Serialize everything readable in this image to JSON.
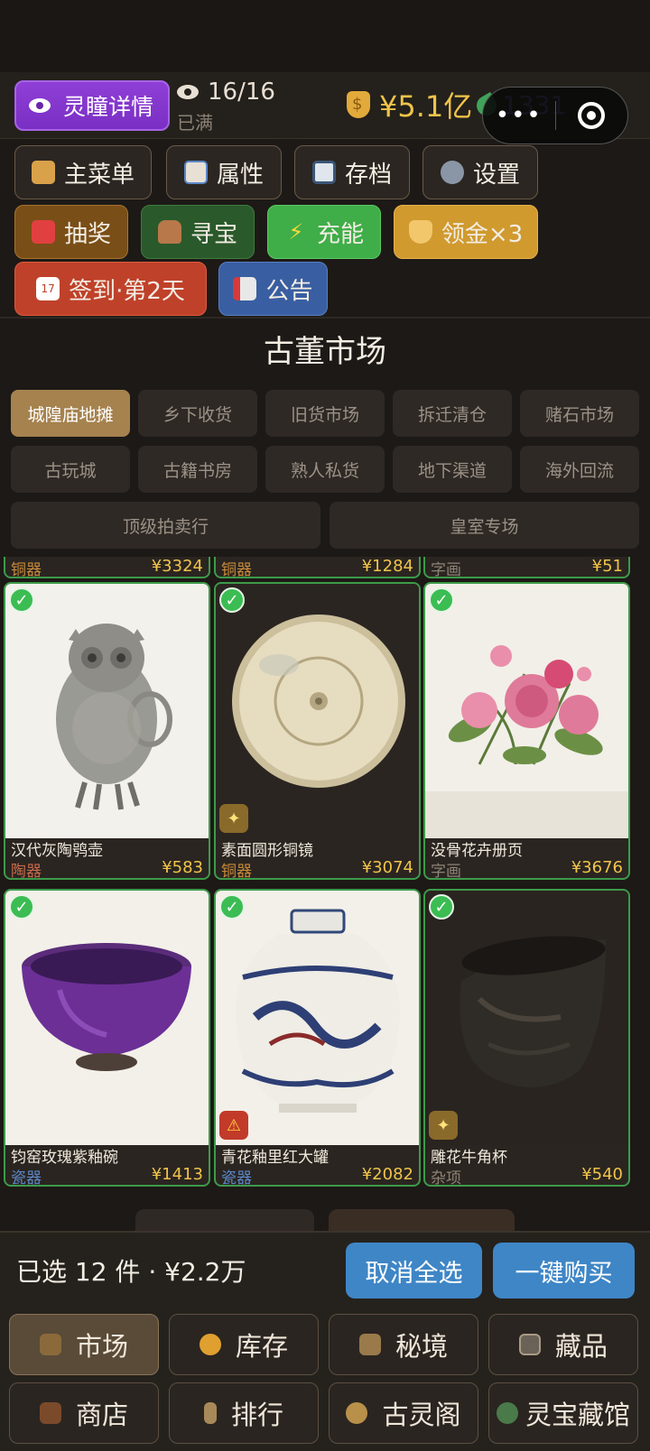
{
  "header": {
    "lingtong_label": "灵瞳详情",
    "view_count": "16/16",
    "view_status": "已满",
    "money": "¥5.1亿",
    "jade": "1331"
  },
  "menu": {
    "row1": [
      {
        "label": "主菜单",
        "icon": "house-icon"
      },
      {
        "label": "属性",
        "icon": "chart-icon"
      },
      {
        "label": "存档",
        "icon": "floppy-icon"
      },
      {
        "label": "设置",
        "icon": "gear-icon"
      }
    ],
    "row2": [
      {
        "label": "抽奖",
        "icon": "dice-icon"
      },
      {
        "label": "寻宝",
        "icon": "vase-icon"
      },
      {
        "label": "充能",
        "icon": "lightning-icon"
      },
      {
        "label": "领金×3",
        "icon": "money-bag-icon"
      }
    ],
    "row3": [
      {
        "label": "签到·第2天",
        "icon": "calendar-icon"
      },
      {
        "label": "公告",
        "icon": "megaphone-icon"
      }
    ],
    "calendar_day": "17"
  },
  "market": {
    "title": "古董市场",
    "tabs_row1": [
      "城隍庙地摊",
      "乡下收货",
      "旧货市场",
      "拆迁清仓",
      "赌石市场"
    ],
    "tabs_row2": [
      "古玩城",
      "古籍书房",
      "熟人私货",
      "地下渠道",
      "海外回流"
    ],
    "tabs_row3": [
      "顶级拍卖行",
      "皇室专场"
    ],
    "active_tab": "城隍庙地摊"
  },
  "partial_row": [
    {
      "category": "铜器",
      "price": "¥3324"
    },
    {
      "category": "铜器",
      "price": "¥1284"
    },
    {
      "category": "字画",
      "price": "¥51"
    }
  ],
  "items": [
    {
      "name": "汉代灰陶鸮壶",
      "category": "陶器",
      "price": "¥583",
      "selected": true,
      "flag": ""
    },
    {
      "name": "素面圆形铜镜",
      "category": "铜器",
      "price": "¥3074",
      "selected": true,
      "flag": "sparkle-icon"
    },
    {
      "name": "没骨花卉册页",
      "category": "字画",
      "price": "¥3676",
      "selected": true,
      "flag": ""
    },
    {
      "name": "钧窑玫瑰紫釉碗",
      "category": "瓷器",
      "price": "¥1413",
      "selected": true,
      "flag": ""
    },
    {
      "name": "青花釉里红大罐",
      "category": "瓷器",
      "price": "¥2082",
      "selected": true,
      "flag": "warning-icon"
    },
    {
      "name": "雕花牛角杯",
      "category": "杂项",
      "price": "¥540",
      "selected": true,
      "flag": "sparkle-icon"
    }
  ],
  "selection": {
    "summary": "已选 12 件 · ¥2.2万",
    "deselect_all": "取消全选",
    "buy_all": "一键购买"
  },
  "nav": {
    "row1": [
      "市场",
      "库存",
      "秘境",
      "藏品"
    ],
    "row2": [
      "商店",
      "排行",
      "古灵阁",
      "灵宝藏馆"
    ],
    "active": "市场"
  },
  "colors": {
    "accent_gold": "#f0c44a",
    "select_green": "#3e9a4b",
    "button_blue": "#3f86c6",
    "purple": "#8f3fd6"
  }
}
